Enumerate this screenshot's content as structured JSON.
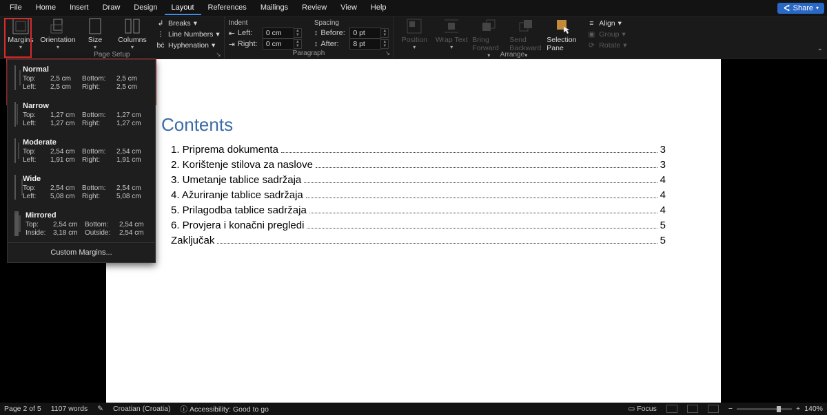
{
  "tabs": [
    "File",
    "Home",
    "Insert",
    "Draw",
    "Design",
    "Layout",
    "References",
    "Mailings",
    "Review",
    "View",
    "Help"
  ],
  "active_tab": "Layout",
  "share_label": "Share",
  "ribbon": {
    "page_setup": {
      "margins": "Margins",
      "orientation": "Orientation",
      "size": "Size",
      "columns": "Columns",
      "breaks": "Breaks",
      "line_numbers": "Line Numbers",
      "hyphenation": "Hyphenation",
      "group_label": "Page Setup"
    },
    "paragraph": {
      "indent_label": "Indent",
      "spacing_label": "Spacing",
      "left": "Left:",
      "right": "Right:",
      "before": "Before:",
      "after": "After:",
      "left_val": "0 cm",
      "right_val": "0 cm",
      "before_val": "0 pt",
      "after_val": "8 pt",
      "group_label": "Paragraph"
    },
    "arrange": {
      "position": "Position",
      "wrap": "Wrap Text",
      "bring": "Bring Forward",
      "send": "Send Backward",
      "selection": "Selection Pane",
      "align": "Align",
      "group": "Group",
      "rotate": "Rotate",
      "group_label": "Arrange"
    }
  },
  "margins_menu": {
    "items": [
      {
        "name": "Normal",
        "thumb": "normal",
        "k1": "Top:",
        "v1": "2,5 cm",
        "k2": "Bottom:",
        "v2": "2,5 cm",
        "k3": "Left:",
        "v3": "2,5 cm",
        "k4": "Right:",
        "v4": "2,5 cm"
      },
      {
        "name": "Narrow",
        "thumb": "narrow",
        "k1": "Top:",
        "v1": "1,27 cm",
        "k2": "Bottom:",
        "v2": "1,27 cm",
        "k3": "Left:",
        "v3": "1,27 cm",
        "k4": "Right:",
        "v4": "1,27 cm"
      },
      {
        "name": "Moderate",
        "thumb": "moderate",
        "k1": "Top:",
        "v1": "2,54 cm",
        "k2": "Bottom:",
        "v2": "2,54 cm",
        "k3": "Left:",
        "v3": "1,91 cm",
        "k4": "Right:",
        "v4": "1,91 cm"
      },
      {
        "name": "Wide",
        "thumb": "wide",
        "k1": "Top:",
        "v1": "2,54 cm",
        "k2": "Bottom:",
        "v2": "2,54 cm",
        "k3": "Left:",
        "v3": "5,08 cm",
        "k4": "Right:",
        "v4": "5,08 cm"
      },
      {
        "name": "Mirrored",
        "thumb": "mirrored",
        "k1": "Top:",
        "v1": "2,54 cm",
        "k2": "Bottom:",
        "v2": "2,54 cm",
        "k3": "Inside:",
        "v3": "3,18 cm",
        "k4": "Outside:",
        "v4": "2,54 cm"
      }
    ],
    "custom": "Custom Margins..."
  },
  "document": {
    "title": "Contents",
    "toc": [
      {
        "text": "1. Priprema dokumenta",
        "page": "3"
      },
      {
        "text": "2. Korištenje stilova za naslove",
        "page": "3"
      },
      {
        "text": "3. Umetanje tablice sadržaja",
        "page": "4"
      },
      {
        "text": "4. Ažuriranje tablice sadržaja",
        "page": "4"
      },
      {
        "text": "5. Prilagodba tablice sadržaja",
        "page": "4"
      },
      {
        "text": "6. Provjera i konačni pregledi",
        "page": "5"
      },
      {
        "text": "Zaključak",
        "page": "5"
      }
    ]
  },
  "status": {
    "page": "Page 2 of 5",
    "words": "1107 words",
    "lang": "Croatian (Croatia)",
    "access": "Accessibility: Good to go",
    "focus": "Focus",
    "zoom": "140%"
  }
}
